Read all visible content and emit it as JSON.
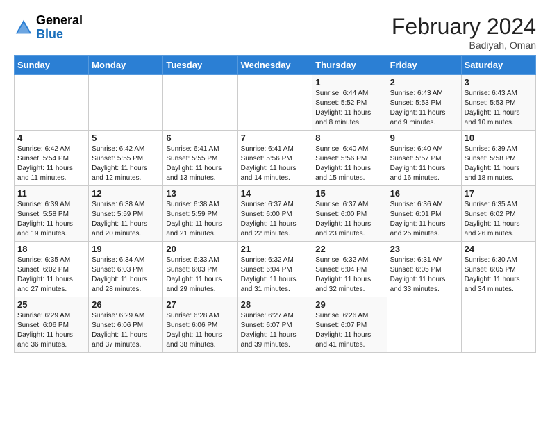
{
  "header": {
    "logo_general": "General",
    "logo_blue": "Blue",
    "month_year": "February 2024",
    "location": "Badiyah, Oman"
  },
  "weekdays": [
    "Sunday",
    "Monday",
    "Tuesday",
    "Wednesday",
    "Thursday",
    "Friday",
    "Saturday"
  ],
  "weeks": [
    [
      {
        "day": "",
        "info": ""
      },
      {
        "day": "",
        "info": ""
      },
      {
        "day": "",
        "info": ""
      },
      {
        "day": "",
        "info": ""
      },
      {
        "day": "1",
        "info": "Sunrise: 6:44 AM\nSunset: 5:52 PM\nDaylight: 11 hours and 8 minutes."
      },
      {
        "day": "2",
        "info": "Sunrise: 6:43 AM\nSunset: 5:53 PM\nDaylight: 11 hours and 9 minutes."
      },
      {
        "day": "3",
        "info": "Sunrise: 6:43 AM\nSunset: 5:53 PM\nDaylight: 11 hours and 10 minutes."
      }
    ],
    [
      {
        "day": "4",
        "info": "Sunrise: 6:42 AM\nSunset: 5:54 PM\nDaylight: 11 hours and 11 minutes."
      },
      {
        "day": "5",
        "info": "Sunrise: 6:42 AM\nSunset: 5:55 PM\nDaylight: 11 hours and 12 minutes."
      },
      {
        "day": "6",
        "info": "Sunrise: 6:41 AM\nSunset: 5:55 PM\nDaylight: 11 hours and 13 minutes."
      },
      {
        "day": "7",
        "info": "Sunrise: 6:41 AM\nSunset: 5:56 PM\nDaylight: 11 hours and 14 minutes."
      },
      {
        "day": "8",
        "info": "Sunrise: 6:40 AM\nSunset: 5:56 PM\nDaylight: 11 hours and 15 minutes."
      },
      {
        "day": "9",
        "info": "Sunrise: 6:40 AM\nSunset: 5:57 PM\nDaylight: 11 hours and 16 minutes."
      },
      {
        "day": "10",
        "info": "Sunrise: 6:39 AM\nSunset: 5:58 PM\nDaylight: 11 hours and 18 minutes."
      }
    ],
    [
      {
        "day": "11",
        "info": "Sunrise: 6:39 AM\nSunset: 5:58 PM\nDaylight: 11 hours and 19 minutes."
      },
      {
        "day": "12",
        "info": "Sunrise: 6:38 AM\nSunset: 5:59 PM\nDaylight: 11 hours and 20 minutes."
      },
      {
        "day": "13",
        "info": "Sunrise: 6:38 AM\nSunset: 5:59 PM\nDaylight: 11 hours and 21 minutes."
      },
      {
        "day": "14",
        "info": "Sunrise: 6:37 AM\nSunset: 6:00 PM\nDaylight: 11 hours and 22 minutes."
      },
      {
        "day": "15",
        "info": "Sunrise: 6:37 AM\nSunset: 6:00 PM\nDaylight: 11 hours and 23 minutes."
      },
      {
        "day": "16",
        "info": "Sunrise: 6:36 AM\nSunset: 6:01 PM\nDaylight: 11 hours and 25 minutes."
      },
      {
        "day": "17",
        "info": "Sunrise: 6:35 AM\nSunset: 6:02 PM\nDaylight: 11 hours and 26 minutes."
      }
    ],
    [
      {
        "day": "18",
        "info": "Sunrise: 6:35 AM\nSunset: 6:02 PM\nDaylight: 11 hours and 27 minutes."
      },
      {
        "day": "19",
        "info": "Sunrise: 6:34 AM\nSunset: 6:03 PM\nDaylight: 11 hours and 28 minutes."
      },
      {
        "day": "20",
        "info": "Sunrise: 6:33 AM\nSunset: 6:03 PM\nDaylight: 11 hours and 29 minutes."
      },
      {
        "day": "21",
        "info": "Sunrise: 6:32 AM\nSunset: 6:04 PM\nDaylight: 11 hours and 31 minutes."
      },
      {
        "day": "22",
        "info": "Sunrise: 6:32 AM\nSunset: 6:04 PM\nDaylight: 11 hours and 32 minutes."
      },
      {
        "day": "23",
        "info": "Sunrise: 6:31 AM\nSunset: 6:05 PM\nDaylight: 11 hours and 33 minutes."
      },
      {
        "day": "24",
        "info": "Sunrise: 6:30 AM\nSunset: 6:05 PM\nDaylight: 11 hours and 34 minutes."
      }
    ],
    [
      {
        "day": "25",
        "info": "Sunrise: 6:29 AM\nSunset: 6:06 PM\nDaylight: 11 hours and 36 minutes."
      },
      {
        "day": "26",
        "info": "Sunrise: 6:29 AM\nSunset: 6:06 PM\nDaylight: 11 hours and 37 minutes."
      },
      {
        "day": "27",
        "info": "Sunrise: 6:28 AM\nSunset: 6:06 PM\nDaylight: 11 hours and 38 minutes."
      },
      {
        "day": "28",
        "info": "Sunrise: 6:27 AM\nSunset: 6:07 PM\nDaylight: 11 hours and 39 minutes."
      },
      {
        "day": "29",
        "info": "Sunrise: 6:26 AM\nSunset: 6:07 PM\nDaylight: 11 hours and 41 minutes."
      },
      {
        "day": "",
        "info": ""
      },
      {
        "day": "",
        "info": ""
      }
    ]
  ]
}
